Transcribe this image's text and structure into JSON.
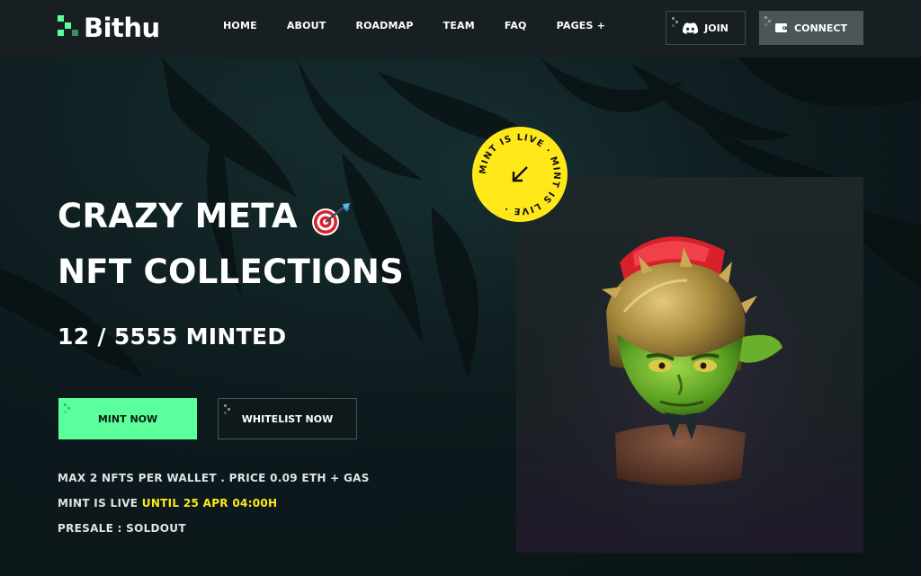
{
  "brand": {
    "name": "Bithu",
    "accent": "#5bff9b",
    "highlight": "#ffe81a",
    "background": "#0d1a1d",
    "header_bg": "#171f22"
  },
  "nav": {
    "items": [
      {
        "label": "HOME"
      },
      {
        "label": "ABOUT"
      },
      {
        "label": "ROADMAP"
      },
      {
        "label": "TEAM"
      },
      {
        "label": "FAQ"
      },
      {
        "label": "PAGES +"
      }
    ]
  },
  "header_actions": {
    "join": {
      "label": "JOIN",
      "icon": "discord-icon"
    },
    "connect": {
      "label": "CONNECT",
      "icon": "wallet-icon"
    }
  },
  "hero": {
    "title_line1": "CRAZY META",
    "title_line2": "NFT COLLECTIONS",
    "title_icon": "dart-target-icon",
    "minted": "12 / 5555 MINTED",
    "mint_button": "MINT NOW",
    "whitelist_button": "WHITELIST NOW",
    "info": {
      "line1": "MAX 2 NFTS PER WALLET . PRICE 0.09 ETH + GAS",
      "line2_prefix": "MINT IS LIVE ",
      "line2_highlight": "UNTIL 25 APR 04:00H",
      "line3": "PRESALE : SOLDOUT"
    }
  },
  "badge": {
    "text": "MINT IS LIVE  ·  MINT IS LIVE  ·  ",
    "icon": "arrow-down-left-icon"
  },
  "artwork": {
    "subject": "nft-goblin-helmet-character"
  }
}
